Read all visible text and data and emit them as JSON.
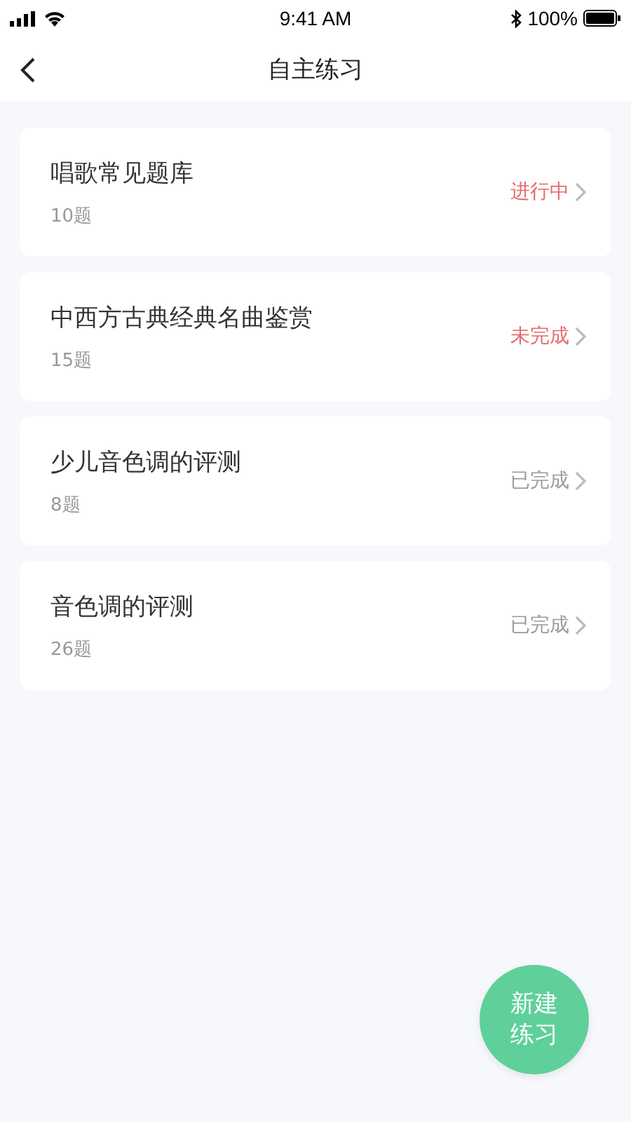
{
  "status_bar": {
    "time": "9:41 AM",
    "battery": "100%"
  },
  "nav": {
    "title": "自主练习"
  },
  "practices": [
    {
      "title": "唱歌常见题库",
      "count": "10题",
      "status": "进行中",
      "kind": "in_progress"
    },
    {
      "title": "中西方古典经典名曲鉴赏",
      "count": "15题",
      "status": "未完成",
      "kind": "incomplete"
    },
    {
      "title": "少儿音色调的评测",
      "count": "8题",
      "status": "已完成",
      "kind": "done"
    },
    {
      "title": "音色调的评测",
      "count": "26题",
      "status": "已完成",
      "kind": "done"
    }
  ],
  "fab": {
    "lines": [
      "新建",
      "练习"
    ]
  }
}
